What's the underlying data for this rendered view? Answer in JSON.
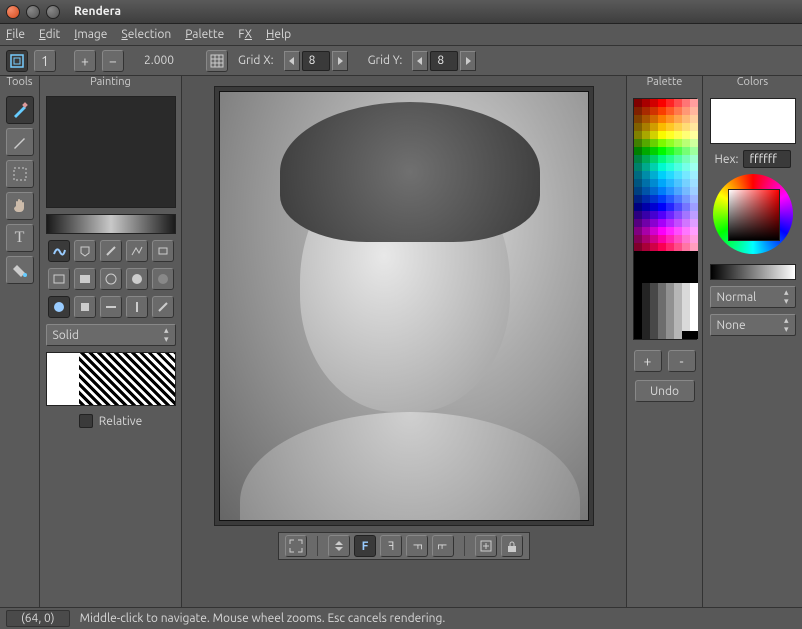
{
  "title": "Rendera",
  "menus": [
    "File",
    "Edit",
    "Image",
    "Selection",
    "Palette",
    "FX",
    "Help"
  ],
  "toolbar": {
    "zoom_one": "1",
    "plus": "+",
    "minus": "−",
    "zoom_value": "2.000",
    "gridx_label": "Grid X:",
    "gridx_value": "8",
    "gridy_label": "Grid Y:",
    "gridy_value": "8"
  },
  "panels": {
    "tools_title": "Tools",
    "painting_title": "Painting",
    "palette_title": "Palette",
    "colors_title": "Colors"
  },
  "painting": {
    "brush_mode": "Solid",
    "relative_label": "Relative"
  },
  "palette": {
    "plus": "+",
    "minus": "-",
    "undo": "Undo"
  },
  "colors": {
    "hex_label": "Hex:",
    "hex_value": "ffffff",
    "blend_mode": "Normal",
    "wrap_mode": "None"
  },
  "status": {
    "coords": "(64, 0)",
    "hint": "Middle-click to navigate. Mouse wheel zooms. Esc cancels rendering."
  },
  "icons": {
    "brush": "brush",
    "pencil": "pencil",
    "select": "select",
    "hand": "hand",
    "text": "text",
    "fill": "fill"
  }
}
